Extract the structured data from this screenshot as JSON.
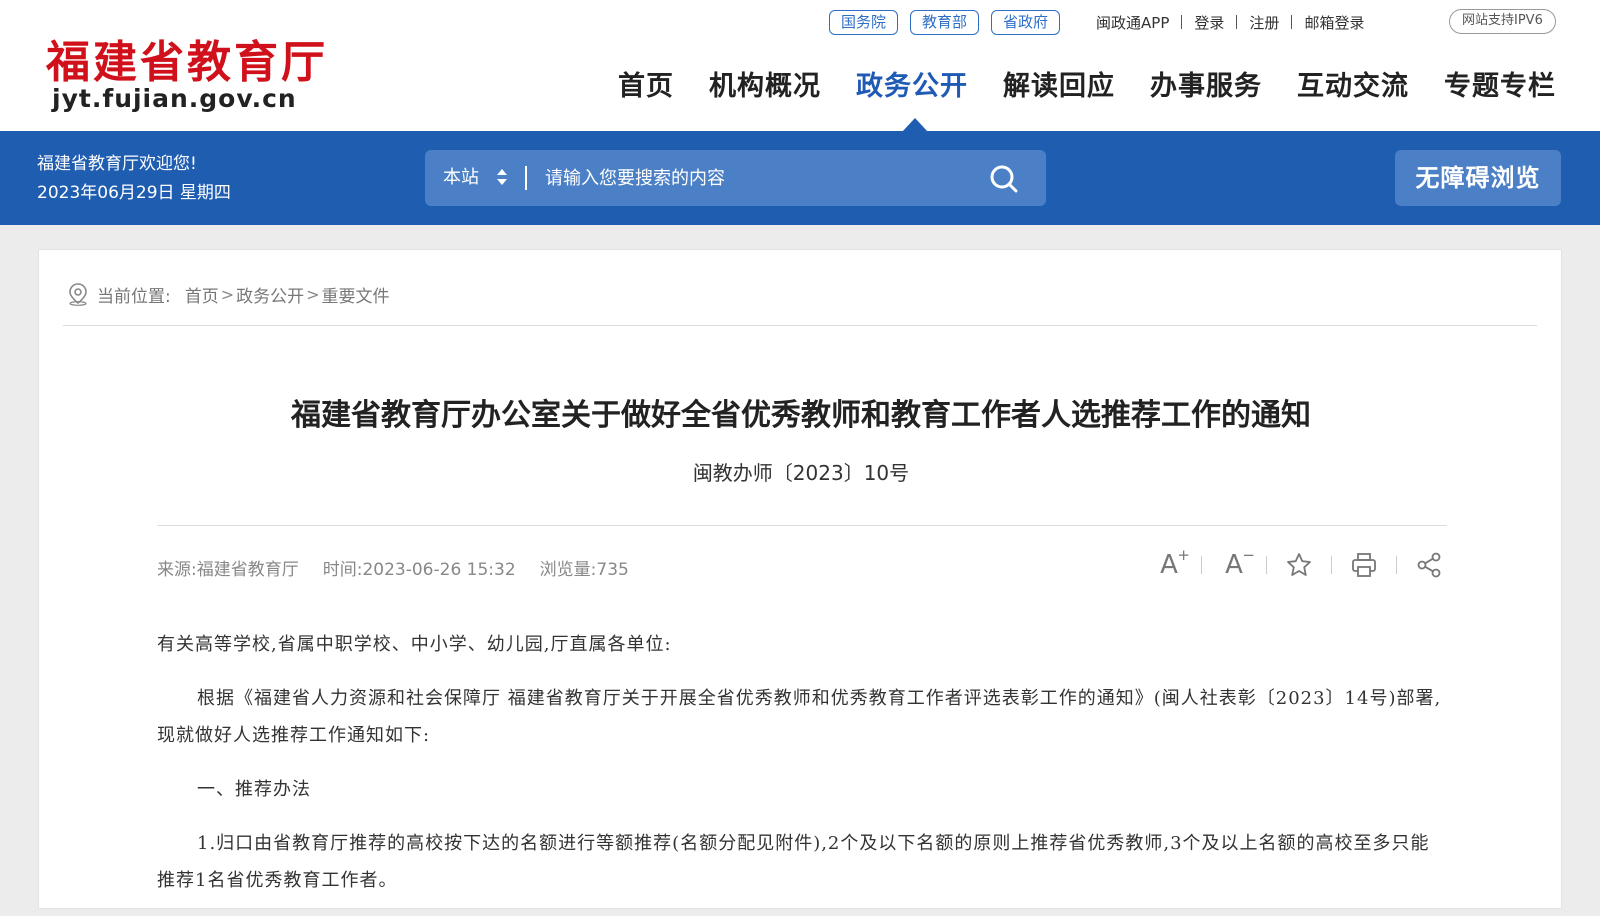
{
  "header": {
    "logo_cn": "福建省教育厅",
    "logo_en": "jyt.fujian.gov.cn",
    "pill_links": [
      "国务院",
      "教育部",
      "省政府"
    ],
    "top_links": [
      "闽政通APP",
      "登录",
      "注册",
      "邮箱登录"
    ],
    "ipv6": "网站支持IPV6",
    "nav": [
      "首页",
      "机构概况",
      "政务公开",
      "解读回应",
      "办事服务",
      "互动交流",
      "专题专栏"
    ],
    "active_nav": "政务公开"
  },
  "bluebar": {
    "welcome": "福建省教育厅欢迎您!",
    "date": "2023年06月29日 星期四",
    "search_scope": "本站",
    "search_placeholder": "请输入您要搜索的内容",
    "accessibility": "无障碍浏览"
  },
  "breadcrumb": {
    "label": "当前位置:",
    "items": [
      "首页",
      "政务公开",
      "重要文件"
    ]
  },
  "article": {
    "title": "福建省教育厅办公室关于做好全省优秀教师和教育工作者人选推荐工作的通知",
    "doc_number": "闽教办师〔2023〕10号",
    "source": "来源:福建省教育厅",
    "time": "时间:2023-06-26 15:32",
    "views": "浏览量:735",
    "tools": {
      "font_increase": "A",
      "font_decrease": "A"
    },
    "paragraphs": [
      "有关高等学校,省属中职学校、中小学、幼儿园,厅直属各单位:",
      "根据《福建省人力资源和社会保障厅 福建省教育厅关于开展全省优秀教师和优秀教育工作者评选表彰工作的通知》(闽人社表彰〔2023〕14号)部署,现就做好人选推荐工作通知如下:",
      "一、推荐办法",
      "1.归口由省教育厅推荐的高校按下达的名额进行等额推荐(名额分配见附件),2个及以下名额的原则上推荐省优秀教师,3个及以上名额的高校至多只能推荐1名省优秀教育工作者。"
    ]
  },
  "colors": {
    "brand_red": "#d0111b",
    "brand_blue": "#1f5db0",
    "search_blue": "#4b80c6"
  }
}
